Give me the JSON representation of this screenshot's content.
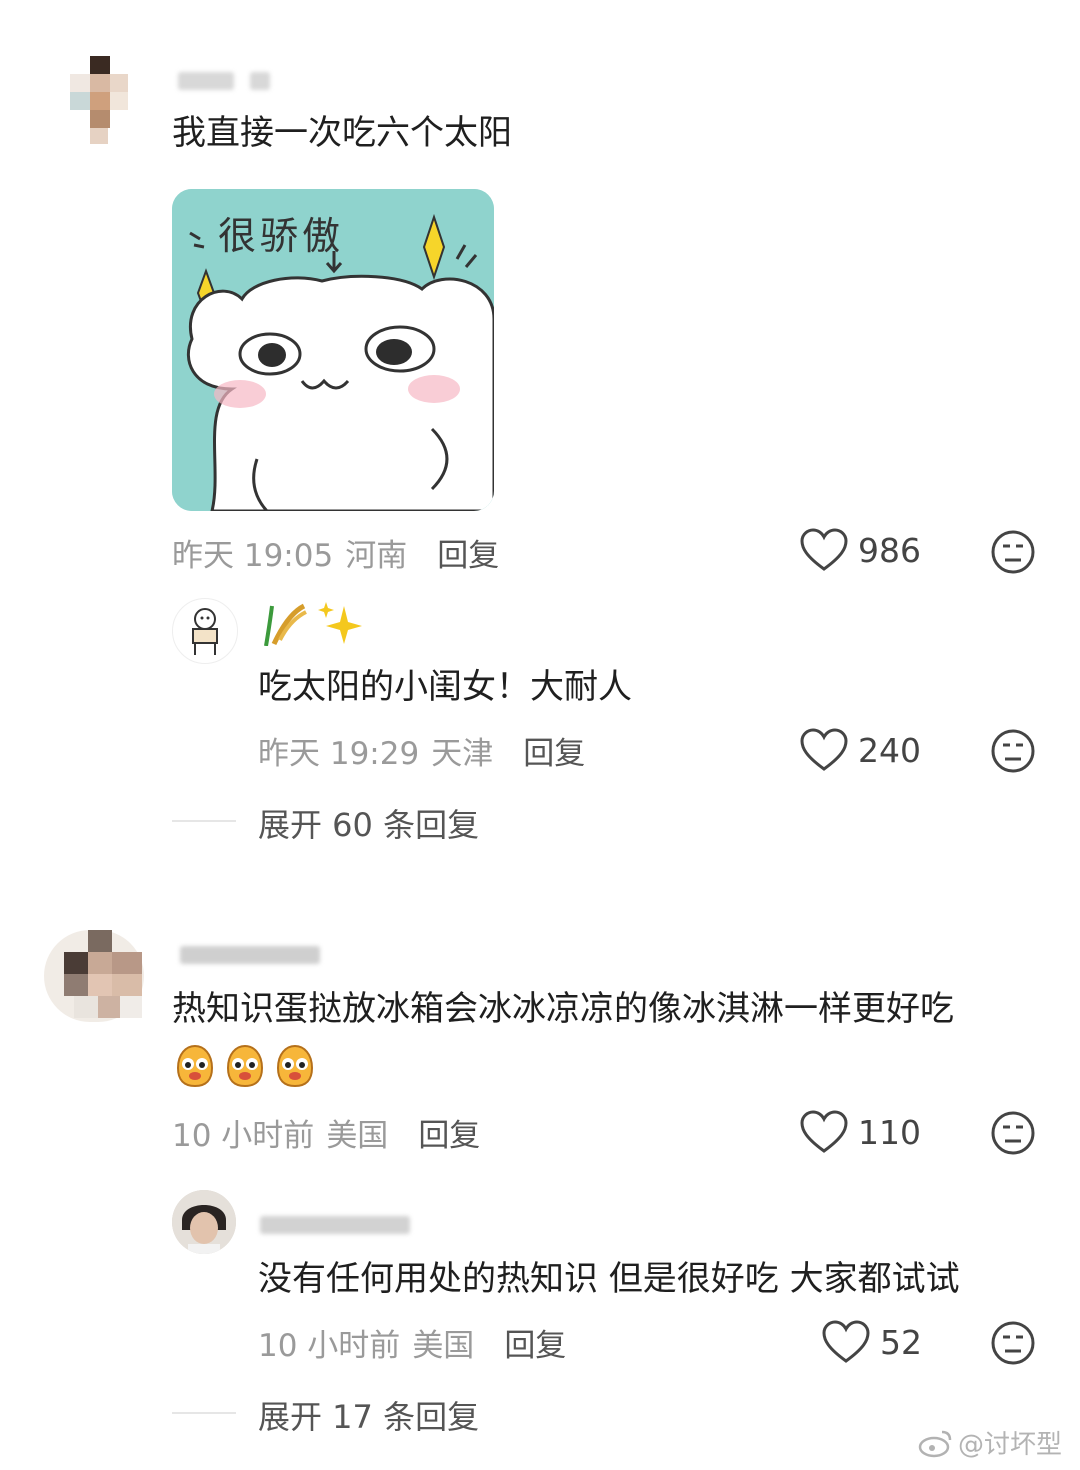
{
  "comments": [
    {
      "text": "我直接一次吃六个太阳",
      "sticker_caption": "很骄傲",
      "time": "昨天 19:05",
      "location": "河南",
      "reply_label": "回复",
      "likes": "986",
      "reply": {
        "text": "吃太阳的小闺女！大耐人",
        "time": "昨天 19:29",
        "location": "天津",
        "reply_label": "回复",
        "likes": "240"
      },
      "expand_label": "展开 60 条回复"
    },
    {
      "text": "热知识蛋挞放冰箱会冰冰凉凉的像冰淇淋一样更好吃",
      "time": "10 小时前",
      "location": "美国",
      "reply_label": "回复",
      "likes": "110",
      "reply": {
        "text": "没有任何用处的热知识 但是很好吃 大家都试试",
        "time": "10 小时前",
        "location": "美国",
        "reply_label": "回复",
        "likes": "52"
      },
      "expand_label": "展开 17 条回复"
    }
  ],
  "watermark": "@讨坏型",
  "icons": {
    "like": "heart-outline-icon",
    "dislike": "meh-face-icon",
    "watermark": "weibo-logo-icon"
  },
  "colors": {
    "sticker_bg": "#8fd3cd",
    "meta_text": "#9a9a9a"
  }
}
